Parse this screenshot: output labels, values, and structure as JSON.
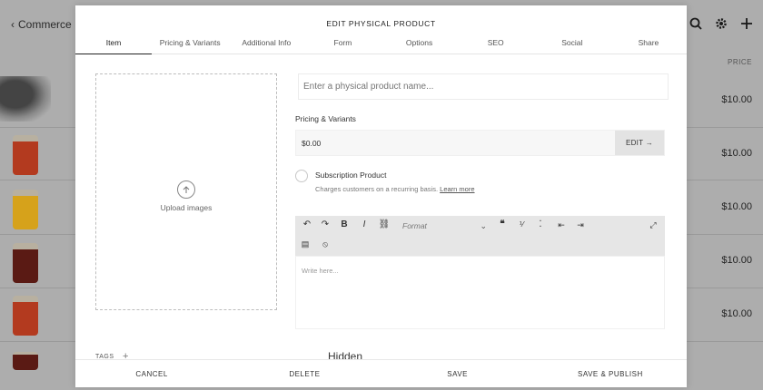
{
  "background": {
    "back_label": "Commerce",
    "price_header": "PRICE",
    "prices": [
      "$10.00",
      "$10.00",
      "$10.00",
      "$10.00",
      "$10.00"
    ],
    "icons": [
      "search-icon",
      "gear-icon",
      "plus-icon"
    ]
  },
  "modal": {
    "title": "EDIT PHYSICAL PRODUCT",
    "tabs": [
      "Item",
      "Pricing & Variants",
      "Additional Info",
      "Form",
      "Options",
      "SEO",
      "Social",
      "Share"
    ],
    "active_tab": "Item",
    "upload_label": "Upload images",
    "name_placeholder": "Enter a physical product name...",
    "pricing_label": "Pricing & Variants",
    "price_value": "$0.00",
    "edit_label": "EDIT →",
    "subscription_title": "Subscription Product",
    "subscription_desc": "Charges customers on a recurring basis.",
    "subscription_link": "Learn more",
    "format_label": "Format",
    "editor_placeholder": "Write here...",
    "tags_label": "TAGS",
    "tags_add": "+",
    "hidden_label": "Hidden",
    "footer": {
      "cancel": "CANCEL",
      "delete": "DELETE",
      "save": "SAVE",
      "save_publish": "SAVE & PUBLISH"
    }
  }
}
